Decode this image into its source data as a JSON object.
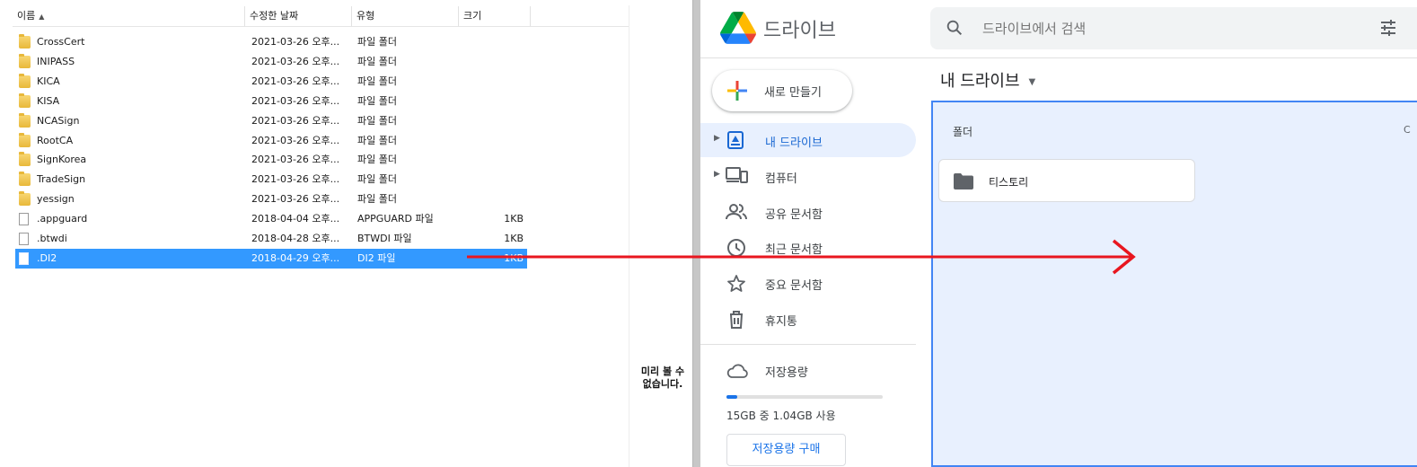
{
  "explorer": {
    "columns": {
      "name": "이름",
      "date": "수정한 날짜",
      "type": "유형",
      "size": "크기"
    },
    "rows": [
      {
        "name": "CrossCert",
        "date": "2021-03-26 오후...",
        "type": "파일 폴더",
        "size": "",
        "kind": "folder"
      },
      {
        "name": "INIPASS",
        "date": "2021-03-26 오후...",
        "type": "파일 폴더",
        "size": "",
        "kind": "folder"
      },
      {
        "name": "KICA",
        "date": "2021-03-26 오후...",
        "type": "파일 폴더",
        "size": "",
        "kind": "folder"
      },
      {
        "name": "KISA",
        "date": "2021-03-26 오후...",
        "type": "파일 폴더",
        "size": "",
        "kind": "folder"
      },
      {
        "name": "NCASign",
        "date": "2021-03-26 오후...",
        "type": "파일 폴더",
        "size": "",
        "kind": "folder"
      },
      {
        "name": "RootCA",
        "date": "2021-03-26 오후...",
        "type": "파일 폴더",
        "size": "",
        "kind": "folder"
      },
      {
        "name": "SignKorea",
        "date": "2021-03-26 오후...",
        "type": "파일 폴더",
        "size": "",
        "kind": "folder"
      },
      {
        "name": "TradeSign",
        "date": "2021-03-26 오후...",
        "type": "파일 폴더",
        "size": "",
        "kind": "folder"
      },
      {
        "name": "yessign",
        "date": "2021-03-26 오후...",
        "type": "파일 폴더",
        "size": "",
        "kind": "folder"
      },
      {
        "name": ".appguard",
        "date": "2018-04-04 오후...",
        "type": "APPGUARD 파일",
        "size": "1KB",
        "kind": "file"
      },
      {
        "name": ".btwdi",
        "date": "2018-04-28 오후...",
        "type": "BTWDI 파일",
        "size": "1KB",
        "kind": "file"
      },
      {
        "name": ".DI2",
        "date": "2018-04-29 오후...",
        "type": "DI2 파일",
        "size": "1KB",
        "kind": "file",
        "selected": true
      }
    ],
    "preview_message": "미리 볼 수\n없습니다."
  },
  "drive": {
    "brand": "드라이브",
    "search_placeholder": "드라이브에서 검색",
    "new_button": "새로 만들기",
    "nav": [
      {
        "label": "내 드라이브",
        "icon": "my-drive-icon",
        "caret": true,
        "active": true
      },
      {
        "label": "컴퓨터",
        "icon": "computers-icon",
        "caret": true,
        "active": false
      },
      {
        "label": "공유 문서함",
        "icon": "shared-icon",
        "caret": false,
        "active": false
      },
      {
        "label": "최근 문서함",
        "icon": "recent-icon",
        "caret": false,
        "active": false
      },
      {
        "label": "중요 문서함",
        "icon": "star-icon",
        "caret": false,
        "active": false
      },
      {
        "label": "휴지통",
        "icon": "trash-icon",
        "caret": false,
        "active": false
      }
    ],
    "storage": {
      "title": "저장용량",
      "usage_text": "15GB 중 1.04GB 사용",
      "fraction_used": 0.069,
      "buy_button": "저장용량 구매"
    },
    "main_title": "내 드라이브",
    "folders_label": "폴더",
    "sort_cut": "C",
    "folders": [
      {
        "name": "티스토리"
      }
    ]
  },
  "colors": {
    "selection": "#3399ff",
    "drive_blue": "#1a73e8",
    "dropzone_bg": "#e8f0fe",
    "arrow": "#e8161f"
  }
}
